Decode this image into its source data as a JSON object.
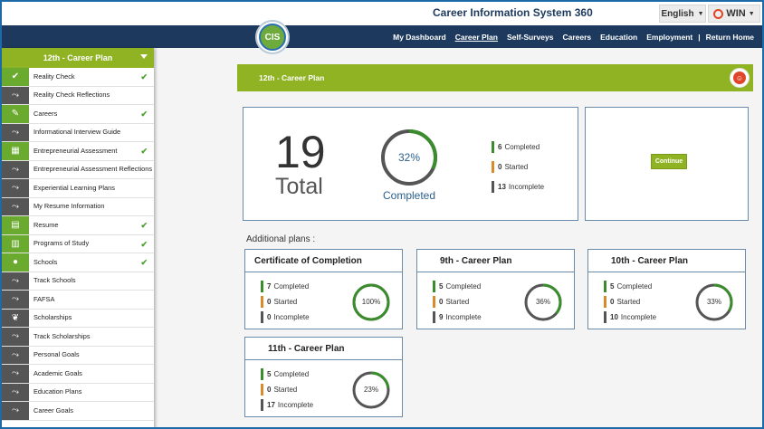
{
  "header": {
    "app_title": "Career Information System 360",
    "language": "English",
    "win_label": "WIN",
    "logo_text": "CIS"
  },
  "nav": {
    "items": [
      "My Dashboard",
      "Career Plan",
      "Self-Surveys",
      "Careers",
      "Education",
      "Employment",
      "Return Home"
    ],
    "active": "Career Plan",
    "separator": "|"
  },
  "sidebar": {
    "header": "12th - Career Plan",
    "items": [
      {
        "label": "Reality Check",
        "icon": "check-badge-icon",
        "done": true
      },
      {
        "label": "Reality Check Reflections",
        "icon": "path-icon",
        "done": false
      },
      {
        "label": "Careers",
        "icon": "tools-icon",
        "done": true
      },
      {
        "label": "Informational Interview Guide",
        "icon": "path-icon",
        "done": false
      },
      {
        "label": "Entrepreneurial Assessment",
        "icon": "store-icon",
        "done": true
      },
      {
        "label": "Entrepreneurial Assessment Reflections",
        "icon": "path-icon",
        "done": false
      },
      {
        "label": "Experiential Learning Plans",
        "icon": "path-icon",
        "done": false
      },
      {
        "label": "My Resume Information",
        "icon": "path-icon",
        "done": false
      },
      {
        "label": "Resume",
        "icon": "document-icon",
        "done": true
      },
      {
        "label": "Programs of Study",
        "icon": "books-icon",
        "done": true
      },
      {
        "label": "Schools",
        "icon": "apple-icon",
        "done": true
      },
      {
        "label": "Track Schools",
        "icon": "path-icon",
        "done": false
      },
      {
        "label": "FAFSA",
        "icon": "path-icon",
        "done": false
      },
      {
        "label": "Scholarships",
        "icon": "laurel-icon",
        "done": false
      },
      {
        "label": "Track Scholarships",
        "icon": "path-icon",
        "done": false
      },
      {
        "label": "Personal Goals",
        "icon": "path-icon",
        "done": false
      },
      {
        "label": "Academic Goals",
        "icon": "path-icon",
        "done": false
      },
      {
        "label": "Education Plans",
        "icon": "path-icon",
        "done": false
      },
      {
        "label": "Career Goals",
        "icon": "path-icon",
        "done": false
      }
    ]
  },
  "plan": {
    "title": "12th - Career Plan",
    "total": "19",
    "total_label": "Total",
    "percent": 32,
    "percent_label": "32%",
    "completed_label": "Completed",
    "stats": [
      {
        "num": "6",
        "label": "Completed",
        "color": "#3a8c2c"
      },
      {
        "num": "0",
        "label": "Started",
        "color": "#d98a2a"
      },
      {
        "num": "13",
        "label": "Incomplete",
        "color": "#555555"
      }
    ],
    "continue_label": "Continue"
  },
  "additional": {
    "label": "Additional plans :",
    "plans": [
      {
        "title": "Certificate of Completion",
        "completed": "7",
        "started": "0",
        "incomplete": "0",
        "percent": 100,
        "percent_label": "100%"
      },
      {
        "title": "9th - Career Plan",
        "completed": "5",
        "started": "0",
        "incomplete": "9",
        "percent": 36,
        "percent_label": "36%"
      },
      {
        "title": "10th - Career Plan",
        "completed": "5",
        "started": "0",
        "incomplete": "10",
        "percent": 33,
        "percent_label": "33%"
      },
      {
        "title": "11th - Career Plan",
        "completed": "5",
        "started": "0",
        "incomplete": "17",
        "percent": 23,
        "percent_label": "23%"
      }
    ],
    "labels": {
      "completed": "Completed",
      "started": "Started",
      "incomplete": "Incomplete"
    }
  },
  "colors": {
    "navy": "#1d3a5e",
    "green": "#90b324",
    "complete": "#3a8c2c",
    "started": "#d98a2a",
    "incomplete": "#555555"
  }
}
